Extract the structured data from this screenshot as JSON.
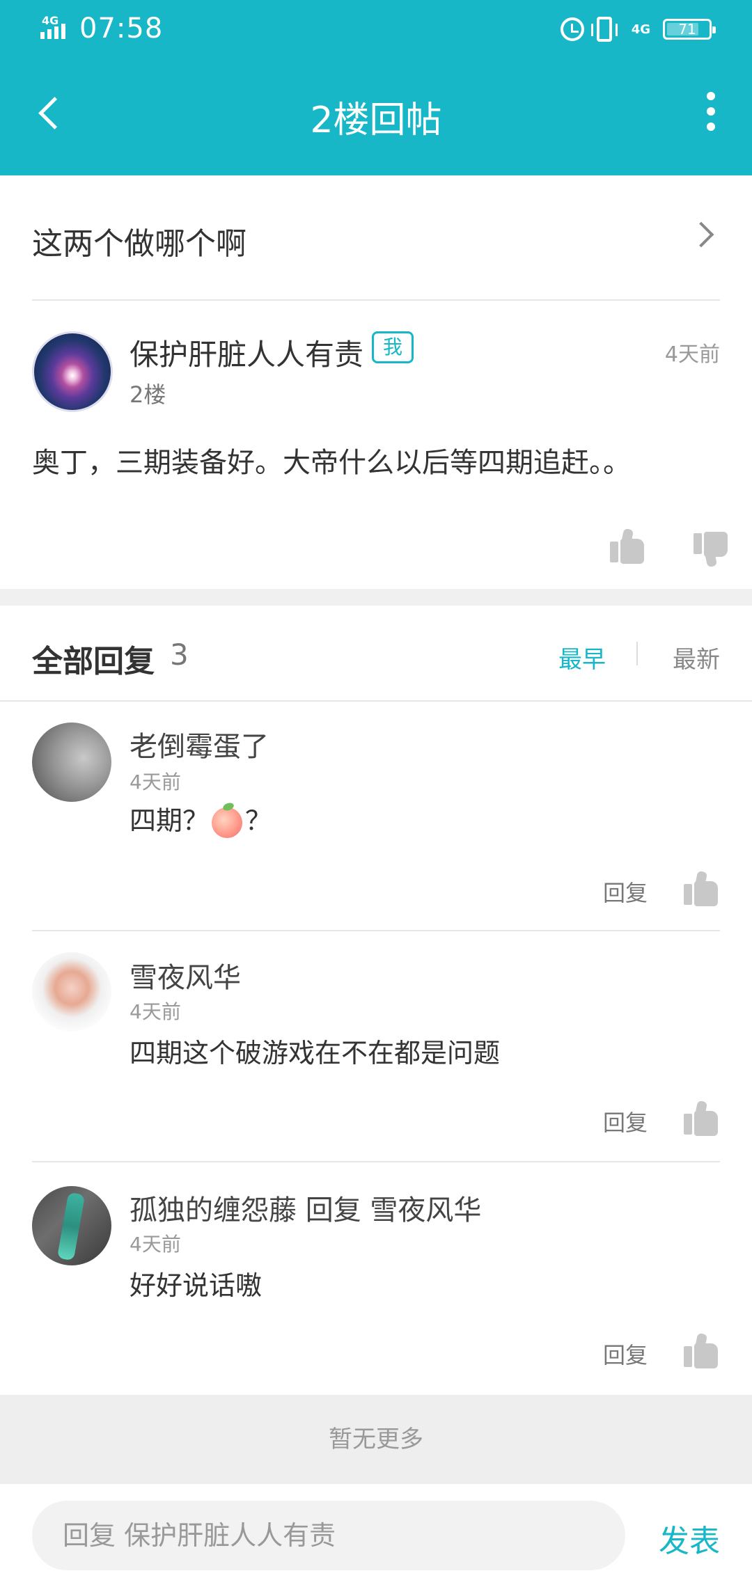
{
  "status_bar": {
    "network": "4G",
    "time": "07:58",
    "network_right": "4G",
    "battery": "71"
  },
  "nav": {
    "title": "2楼回帖"
  },
  "topic": {
    "title": "这两个做哪个啊"
  },
  "post": {
    "author": "保护肝脏人人有责",
    "me_tag": "我",
    "floor": "2楼",
    "time": "4天前",
    "content": "奥丁，三期装备好。大帝什么以后等四期追赶。。"
  },
  "replies_header": {
    "label": "全部回复",
    "count": "3",
    "sort_earliest": "最早",
    "sort_latest": "最新"
  },
  "replies": [
    {
      "name": "老倒霉蛋了",
      "time": "4天前",
      "content_before": "四期？",
      "content_after": "？",
      "reply_label": "回复"
    },
    {
      "name": "雪夜风华",
      "time": "4天前",
      "content": "四期这个破游戏在不在都是问题",
      "reply_label": "回复"
    },
    {
      "name": "孤独的缠怨藤 回复 雪夜风华",
      "time": "4天前",
      "content": "好好说话嗷",
      "reply_label": "回复"
    }
  ],
  "footer": {
    "no_more": "暂无更多"
  },
  "composer": {
    "placeholder": "回复 保护肝脏人人有责",
    "send": "发表"
  },
  "colors": {
    "accent": "#17b7c8",
    "divider": "#e6e6e6"
  },
  "icons": [
    "back-icon",
    "more-icon",
    "chevron-right-icon",
    "thumb-up-icon",
    "thumb-down-icon",
    "peach-emoji",
    "alarm-icon",
    "vibrate-icon",
    "battery-icon",
    "signal-icon"
  ]
}
